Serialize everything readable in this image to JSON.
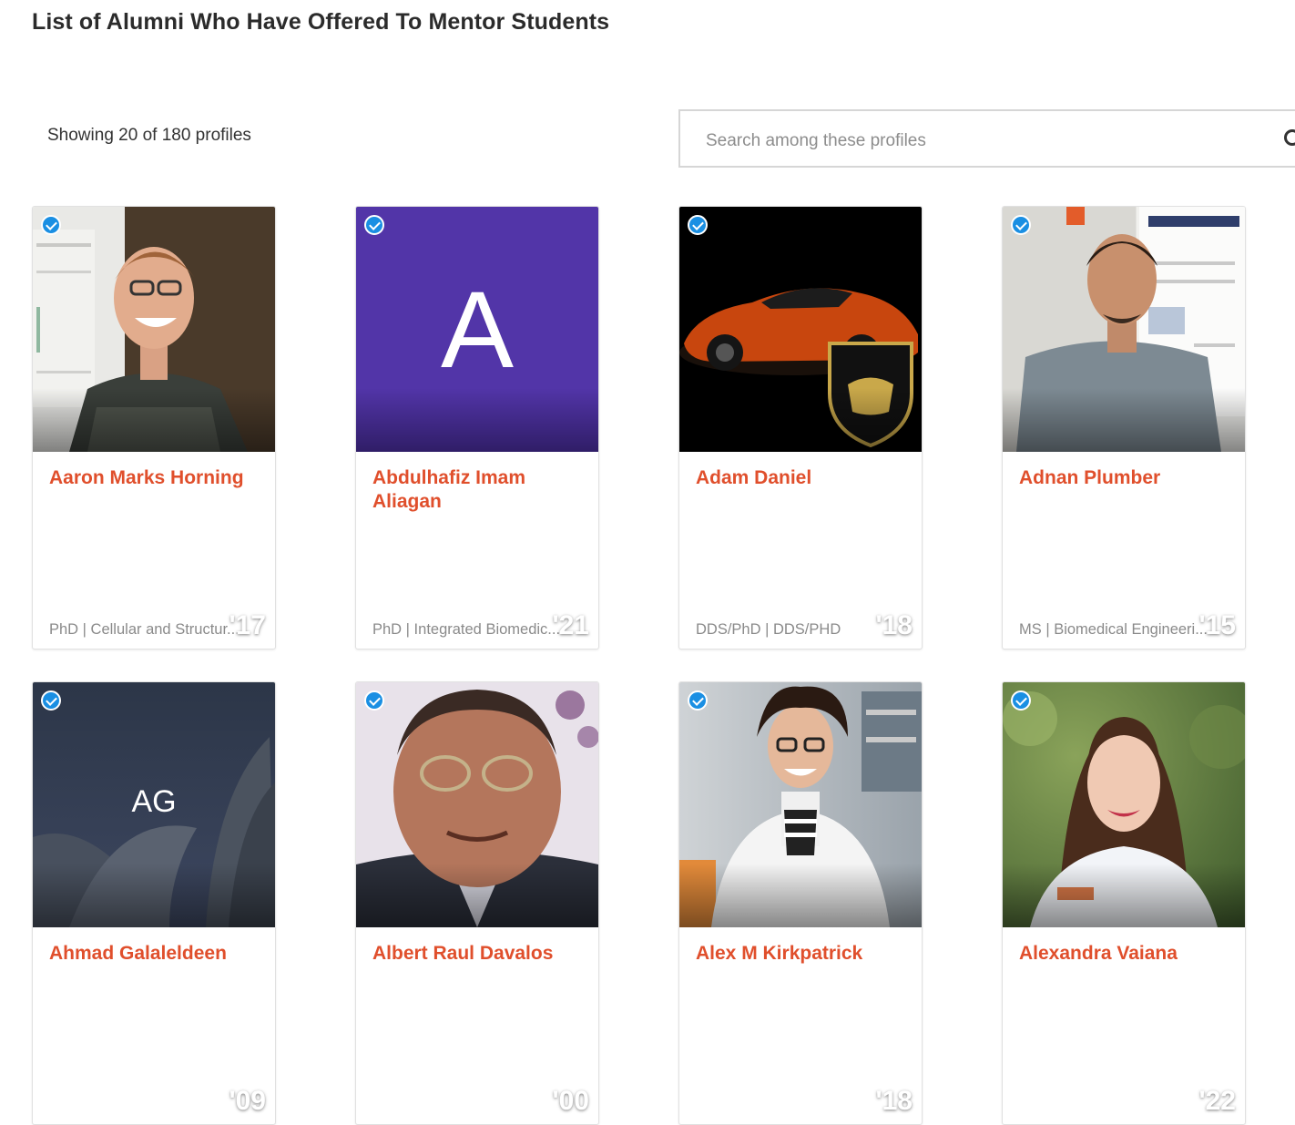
{
  "header": {
    "title": "List of Alumni Who Have Offered To Mentor Students"
  },
  "results": {
    "count_text": "Showing 20 of 180 profiles"
  },
  "search": {
    "placeholder": "Search among these profiles",
    "value": ""
  },
  "colors": {
    "accent": "#e04f2c",
    "verified": "#1a8fe3"
  },
  "profiles": [
    {
      "name": "Aaron Marks Horning",
      "year": "'17",
      "degree": "PhD | Cellular and Structur...",
      "photo": "photo"
    },
    {
      "name": "Abdulhafiz Imam Aliagan",
      "year": "'21",
      "degree": "PhD | Integrated Biomedic...",
      "photo": "letter",
      "initials": "A"
    },
    {
      "name": "Adam Daniel",
      "year": "'18",
      "degree": "DDS/PhD | DDS/PHD",
      "photo": "car"
    },
    {
      "name": "Adnan Plumber",
      "year": "'15",
      "degree": "MS | Biomedical Engineeri...",
      "photo": "photo"
    },
    {
      "name": "Ahmad Galaleldeen",
      "year": "'09",
      "degree": "",
      "photo": "initials",
      "initials": "AG"
    },
    {
      "name": "Albert Raul Davalos",
      "year": "'00",
      "degree": "",
      "photo": "photo"
    },
    {
      "name": "Alex M Kirkpatrick",
      "year": "'18",
      "degree": "",
      "photo": "photo"
    },
    {
      "name": "Alexandra Vaiana",
      "year": "'22",
      "degree": "",
      "photo": "photo"
    }
  ]
}
